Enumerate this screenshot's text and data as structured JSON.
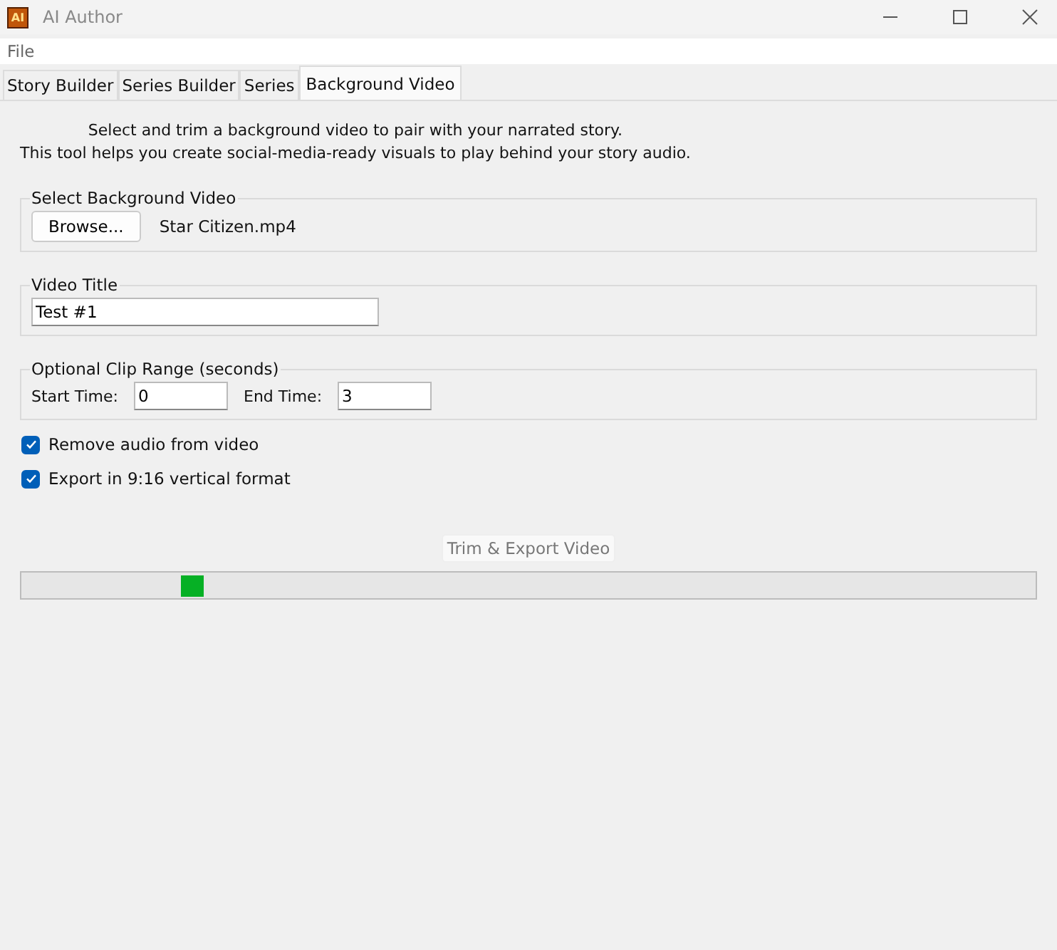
{
  "window": {
    "title": "AI Author",
    "icon_text": "AI"
  },
  "menu": [
    "File"
  ],
  "tabs": [
    {
      "label": "Story Builder",
      "selected": false
    },
    {
      "label": "Series Builder",
      "selected": false
    },
    {
      "label": "Series",
      "selected": false
    },
    {
      "label": "Background Video",
      "selected": true
    }
  ],
  "intro": [
    "Select and trim a background video to pair with your narrated story.",
    "This tool helps you create social-media-ready visuals to play behind your story audio."
  ],
  "video_group": {
    "title": "Select Background Video",
    "button": "Browse...",
    "file": "Star Citizen.mp4"
  },
  "title_group": {
    "title": "Video Title",
    "value": "Test #1"
  },
  "clip_group": {
    "title": "Optional Clip Range (seconds)",
    "start_label": "Start Time:",
    "start_value": "0",
    "end_label": "End Time:",
    "end_value": "3"
  },
  "options": [
    {
      "label": "Remove audio from video",
      "checked": true
    },
    {
      "label": "Export in 9:16 vertical format",
      "checked": true
    }
  ],
  "export_button": {
    "label": "Trim & Export Video",
    "disabled": true
  },
  "progress": {
    "busy": true
  }
}
